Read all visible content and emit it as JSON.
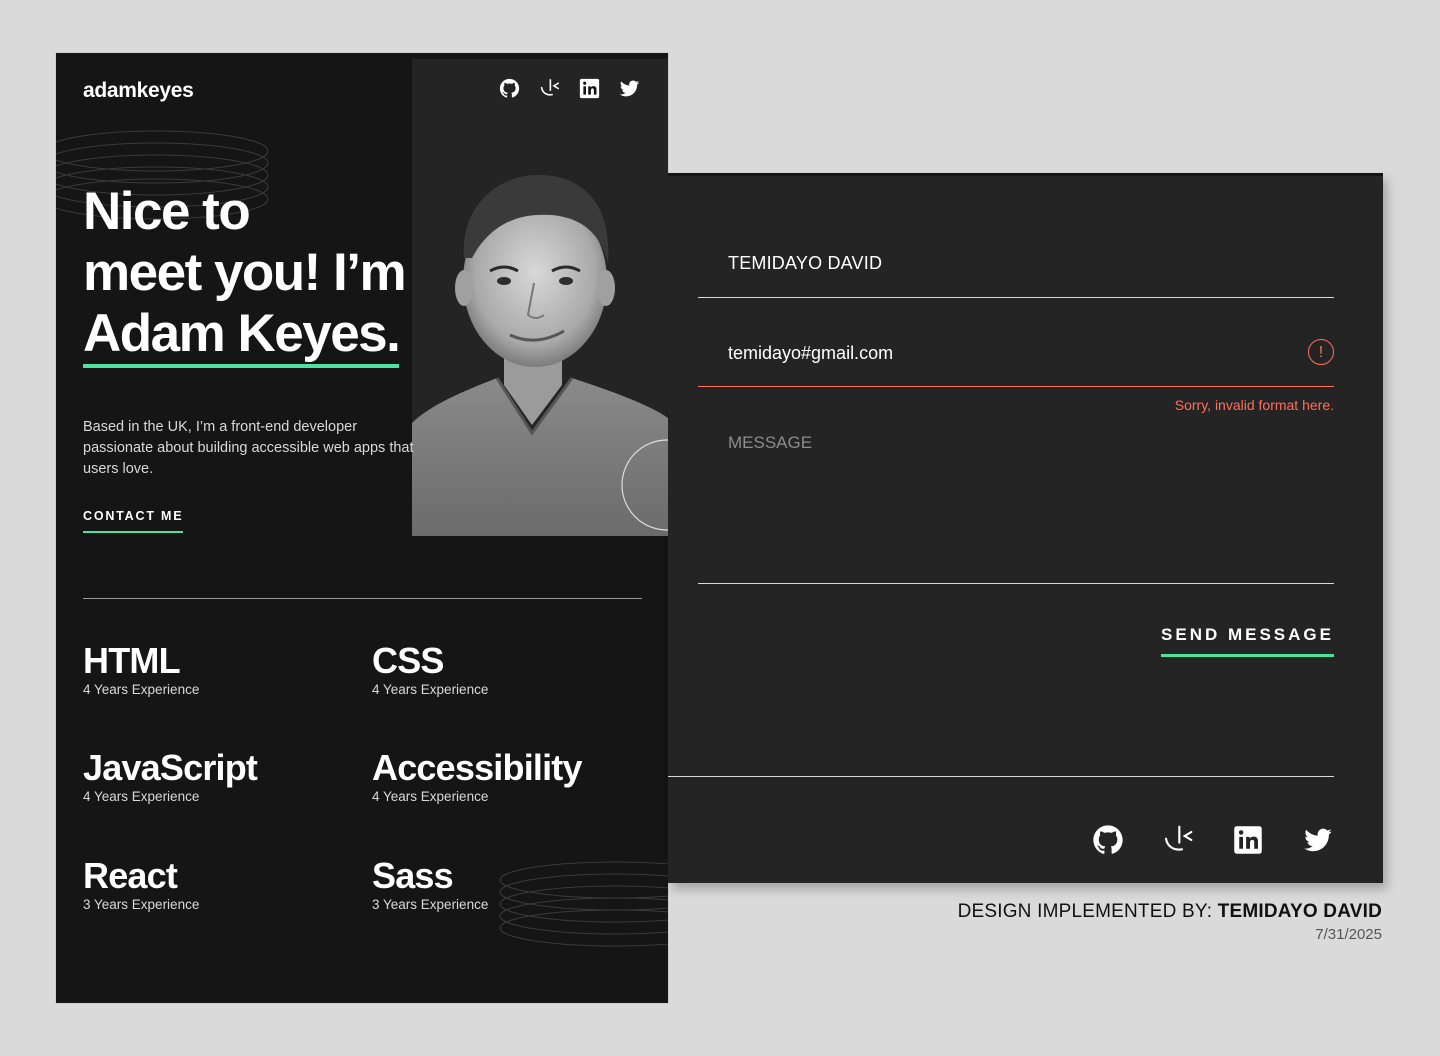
{
  "site": {
    "logo": "adamkeyes",
    "social_icons": [
      "github-icon",
      "frontend-mentor-icon",
      "linkedin-icon",
      "twitter-icon"
    ]
  },
  "hero": {
    "title_line1": "Nice to",
    "title_line2": "meet you! I’m",
    "title_line3": "Adam Keyes.",
    "description": "Based in the UK, I’m a front-end developer passionate about building accessible web apps that users love.",
    "cta": "CONTACT ME"
  },
  "skills": [
    {
      "name": "HTML",
      "experience": "4 Years Experience"
    },
    {
      "name": "CSS",
      "experience": "4 Years Experience"
    },
    {
      "name": "JavaScript",
      "experience": "4 Years Experience"
    },
    {
      "name": "Accessibility",
      "experience": "4 Years Experience"
    },
    {
      "name": "React",
      "experience": "3 Years Experience"
    },
    {
      "name": "Sass",
      "experience": "3 Years Experience"
    }
  ],
  "contact_form": {
    "name_value": "TEMIDAYO DAVID",
    "email_value": "temidayo#gmail.com",
    "email_error_icon": "!",
    "email_error": "Sorry, invalid format here.",
    "message_placeholder": "MESSAGE",
    "send_label": "SEND MESSAGE"
  },
  "credit": {
    "prefix": "DESIGN IMPLEMENTED BY: ",
    "author": "TEMIDAYO DAVID",
    "date": "7/31/2025"
  },
  "colors": {
    "accent": "#4ee1a0",
    "error": "#ff6f5b",
    "dark": "#151515",
    "card": "#242424"
  }
}
